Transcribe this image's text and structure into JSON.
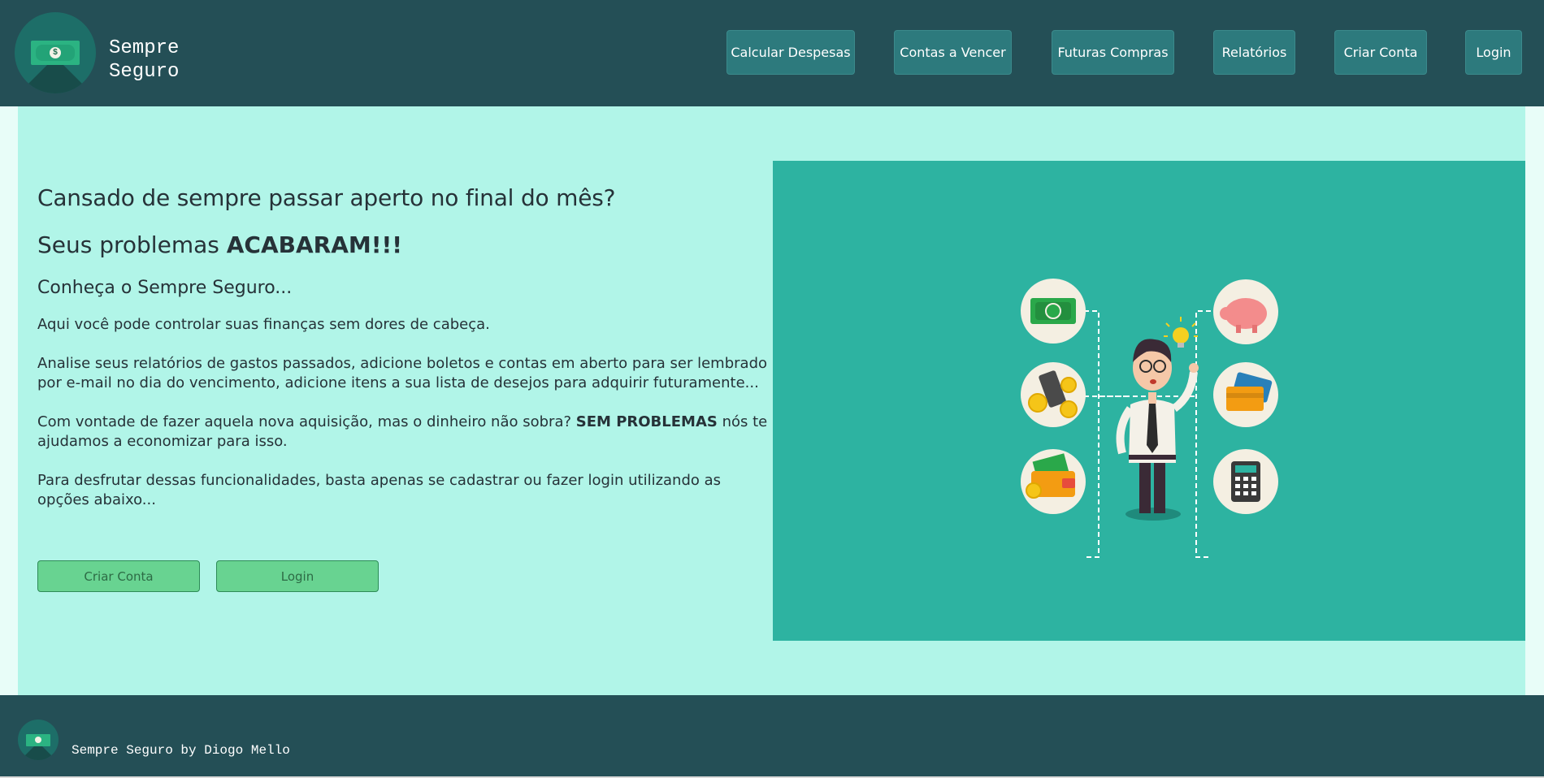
{
  "header": {
    "brand_line1": "Sempre",
    "brand_line2": "Seguro",
    "nav": [
      {
        "label": "Calcular Despesas"
      },
      {
        "label": "Contas a Vencer"
      },
      {
        "label": "Futuras Compras"
      },
      {
        "label": "Relatórios"
      },
      {
        "label": "Criar Conta"
      },
      {
        "label": "Login"
      }
    ]
  },
  "main": {
    "lead": "Cansado de sempre passar aperto no final do mês?",
    "big_prefix": "Seus problemas ",
    "big_bold": "ACABARAM!!!",
    "sub": "Conheça o Sempre Seguro...",
    "p1": "Aqui você pode controlar suas finanças sem dores de cabeça.",
    "p2": "Analise seus relatórios de gastos passados, adicione boletos e contas em aberto para ser lembrado por e-mail no dia do vencimento, adicione itens a sua lista de desejos para adquirir futuramente...",
    "p3_prefix": "Com vontade de fazer aquela nova aquisição, mas o dinheiro não sobra? ",
    "p3_bold": "SEM PROBLEMAS",
    "p3_suffix": " nós te ajudamos a economizar para isso.",
    "p4": "Para desfrutar dessas funcionalidades, basta apenas se cadastrar ou fazer login utilizando as opções abaixo...",
    "btn_create": "Criar Conta",
    "btn_login": "Login"
  },
  "footer": {
    "text": "Sempre Seguro by Diogo Mello"
  },
  "colors": {
    "header_bg": "#244f56",
    "main_bg": "#b1f5e8",
    "hero_bg": "#2db3a1",
    "nav_btn": "#2d7a7d",
    "green_btn": "#68d391"
  }
}
